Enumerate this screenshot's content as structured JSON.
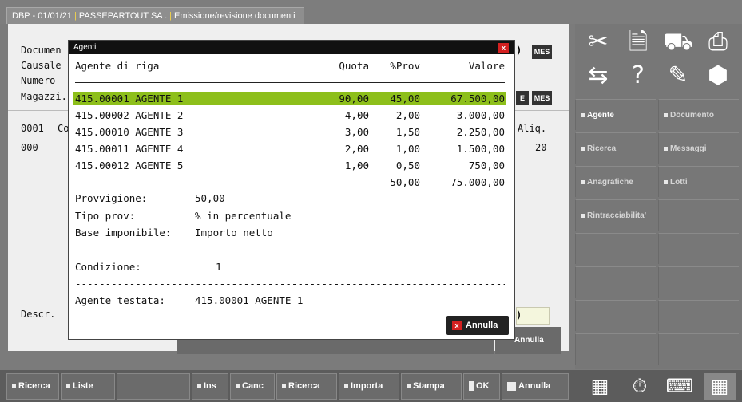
{
  "window": {
    "tab_part1": "DBP - 01/01/21",
    "tab_part2": "PASSEPARTOUT SA .",
    "tab_part3": "Emissione/revisione documenti"
  },
  "background_form": {
    "labels": [
      "Documen",
      "Causale",
      "Numero",
      "Magazzi."
    ],
    "row_code": "0001",
    "row_code_suffix": "Co",
    "row_000": "000",
    "aliq_label": "Aliq.",
    "aliq_value": "20",
    "descr_label": "Descr.",
    "mes1": "MES",
    "mes2": "MES",
    "paren": ")",
    "paren2": ")",
    "e_label": "E",
    "ghost_annulla": "Annulla"
  },
  "dialog": {
    "title": "Agenti",
    "close_label": "x",
    "headers": {
      "agente": "Agente di riga",
      "quota": "Quota",
      "prov": "%Prov",
      "valore": "Valore"
    },
    "rows": [
      {
        "agente": "415.00001 AGENTE 1",
        "quota": "90,00",
        "prov": "45,00",
        "valore": "67.500,00",
        "selected": true
      },
      {
        "agente": "415.00002 AGENTE 2",
        "quota": "4,00",
        "prov": "2,00",
        "valore": "3.000,00",
        "selected": false
      },
      {
        "agente": "415.00010 AGENTE 3",
        "quota": "3,00",
        "prov": "1,50",
        "valore": "2.250,00",
        "selected": false
      },
      {
        "agente": "415.00011 AGENTE 4",
        "quota": "2,00",
        "prov": "1,00",
        "valore": "1.500,00",
        "selected": false
      },
      {
        "agente": "415.00012 AGENTE 5",
        "quota": "1,00",
        "prov": "0,50",
        "valore": "750,00",
        "selected": false
      }
    ],
    "totals": {
      "prov": "50,00",
      "valore": "75.000,00"
    },
    "provvigione_label": "Provvigione:",
    "provvigione_value": "50,00",
    "tipo_prov_label": "Tipo prov:",
    "tipo_prov_value": "% in percentuale",
    "base_label": "Base imponibile:",
    "base_value": "Importo netto",
    "condizione_label": "Condizione:",
    "condizione_value": "1",
    "agente_testata_label": "Agente testata:",
    "agente_testata_value": "415.00001 AGENTE 1",
    "annulla_label": "Annulla",
    "annulla_icon": "x"
  },
  "right_panel": {
    "tool_icons": [
      "scissors-icon",
      "document-icon",
      "truck-icon",
      "printer-icon",
      "transfer-icon",
      "help-icon",
      "edit-icon",
      "box-icon"
    ],
    "menu": [
      {
        "label": "Agente",
        "active": true
      },
      {
        "label": "Documento",
        "active": false
      },
      {
        "label": "Ricerca",
        "active": false
      },
      {
        "label": "Messaggi",
        "active": false
      },
      {
        "label": "Anagrafiche",
        "active": false
      },
      {
        "label": "Lotti",
        "active": false
      },
      {
        "label": "Rintracciabilita'",
        "active": false
      }
    ]
  },
  "bottom_toolbar": {
    "buttons": [
      "Ricerca",
      "Liste",
      "Ins",
      "Canc",
      "Ricerca",
      "Importa",
      "Stampa",
      "OK",
      "Annulla"
    ],
    "icons": [
      "calculator-icon",
      "stopwatch-icon",
      "keyboard-icon",
      "grid-icon"
    ]
  },
  "colors": {
    "selection": "#8dbf1b",
    "close": "#d42020",
    "accent_separator": "#f3d44a"
  }
}
